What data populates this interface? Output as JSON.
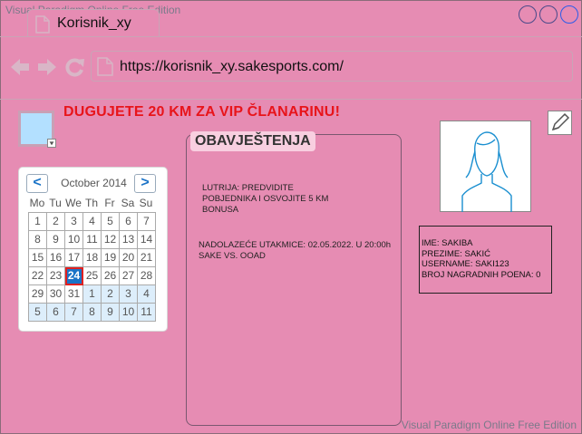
{
  "watermark": {
    "top": "Visual Paradigm Online Free Edition",
    "bottom": "Visual Paradigm Online Free Edition"
  },
  "browser": {
    "tab_title": "Korisnik_xy",
    "url": "https://korisnik_xy.sakesports.com/",
    "icons": [
      "back-arrow-icon",
      "forward-arrow-icon",
      "refresh-icon",
      "page-icon"
    ]
  },
  "banner": {
    "text": "DUGUJETE 20 KM ZA VIP ČLANARINU!",
    "color": "#e8141a"
  },
  "calendar": {
    "month_label": "October 2014",
    "prev_label": "<",
    "next_label": ">",
    "weekdays": [
      "Mo",
      "Tu",
      "We",
      "Th",
      "Fr",
      "Sa",
      "Su"
    ],
    "days": [
      "1",
      "2",
      "3",
      "4",
      "5",
      "6",
      "7",
      "8",
      "9",
      "10",
      "11",
      "12",
      "13",
      "14",
      "15",
      "16",
      "17",
      "18",
      "19",
      "20",
      "21",
      "22",
      "23",
      "24",
      "25",
      "26",
      "27",
      "28",
      "29",
      "30",
      "31",
      "1",
      "2",
      "3",
      "4",
      "5",
      "6",
      "7",
      "8",
      "9",
      "10",
      "11"
    ],
    "selected_day": "24"
  },
  "notices": {
    "title": "OBAVJEŠTENJA",
    "items": [
      [
        "LUTRIJA: PREDVIDITE",
        "POBJEDNIKA I OSVOJITE 5 KM",
        "BONUSA"
      ],
      [
        "NADOLAZEĆE UTAKMICE: 02.05.2022. U 20:00h",
        "SAKE VS. OOAD"
      ]
    ]
  },
  "user": {
    "lines": [
      "IME: SAKIBA",
      "PREZIME: SAKIĆ",
      "USERNAME: SAKI123",
      "BROJ NAGRADNIH POENA: 0"
    ]
  },
  "colors": {
    "background": "#e68cb3",
    "accent_blue": "#1a73c7",
    "today_border": "#e02020"
  }
}
